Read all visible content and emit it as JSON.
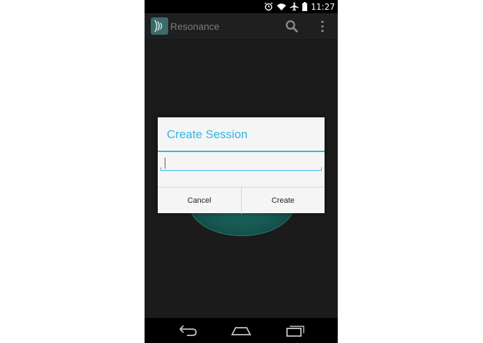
{
  "status_bar": {
    "time": "11:27",
    "icons": [
      "alarm-icon",
      "wifi-icon",
      "airplane-icon",
      "battery-icon"
    ]
  },
  "action_bar": {
    "title": "Resonance",
    "icons": [
      "app-logo-icon",
      "search-icon",
      "overflow-menu-icon"
    ]
  },
  "dialog": {
    "title": "Create Session",
    "input": {
      "value": "",
      "placeholder": ""
    },
    "buttons": {
      "cancel": "Cancel",
      "create": "Create"
    }
  },
  "nav_bar": {
    "icons": [
      "back-icon",
      "home-icon",
      "recents-icon"
    ]
  },
  "colors": {
    "accent": "#33b5e5",
    "teal": "#1f6d66",
    "background": "#1b1b1b"
  }
}
